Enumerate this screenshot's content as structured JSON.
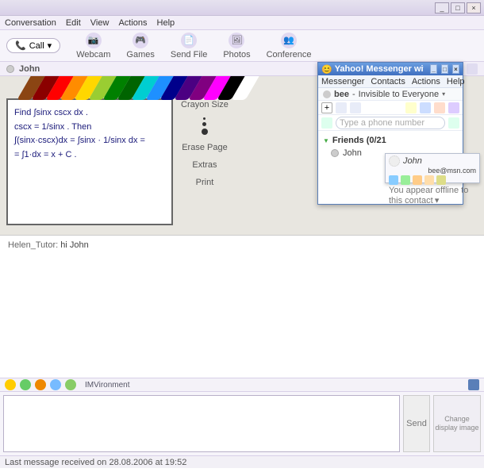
{
  "main": {
    "menus": {
      "conversation": "Conversation",
      "edit": "Edit",
      "view": "View",
      "actions": "Actions",
      "help": "Help"
    },
    "toolbar": {
      "call": "Call",
      "webcam": "Webcam",
      "games": "Games",
      "sendfile": "Send File",
      "photos": "Photos",
      "conference": "Conference"
    },
    "contact_name": "John",
    "whiteboard": {
      "line1": "Find ∫sinx cscx dx .",
      "line2": "cscx = 1/sinx . Then",
      "line3": "∫(sinx·cscx)dx = ∫sinx · 1/sinx dx =",
      "line4": "= ∫1·dx = x + C .",
      "controls": {
        "crayon_size": "Crayon Size",
        "erase": "Erase Page",
        "extras": "Extras",
        "print": "Print"
      }
    },
    "chat": {
      "sender": "Helen_Tutor:",
      "msg": "hi John"
    },
    "imvironment": "IMVironment",
    "send": "Send",
    "change_img": "Change display image",
    "status": "Last message received on 28.08.2006 at 19:52"
  },
  "messenger": {
    "title": "Yahoo! Messenger with Voice (BETA)",
    "menus": {
      "messenger": "Messenger",
      "contacts": "Contacts",
      "actions": "Actions",
      "help": "Help"
    },
    "username": "bee",
    "presence": "Invisible to Everyone",
    "phone_placeholder": "Type a phone number",
    "friends_header": "Friends (0/21",
    "friend1": "John"
  },
  "contact_card": {
    "name": "John",
    "address": "bee@msn.com",
    "status_note": "You appear offline to this contact"
  },
  "crayons": [
    "#8B4513",
    "#8B0000",
    "#FF0000",
    "#FF8C00",
    "#FFD700",
    "#9ACD32",
    "#008000",
    "#006400",
    "#00CED1",
    "#1E90FF",
    "#00008B",
    "#4B0082",
    "#800080",
    "#FF00FF",
    "#000000",
    "#FFFFFF"
  ]
}
